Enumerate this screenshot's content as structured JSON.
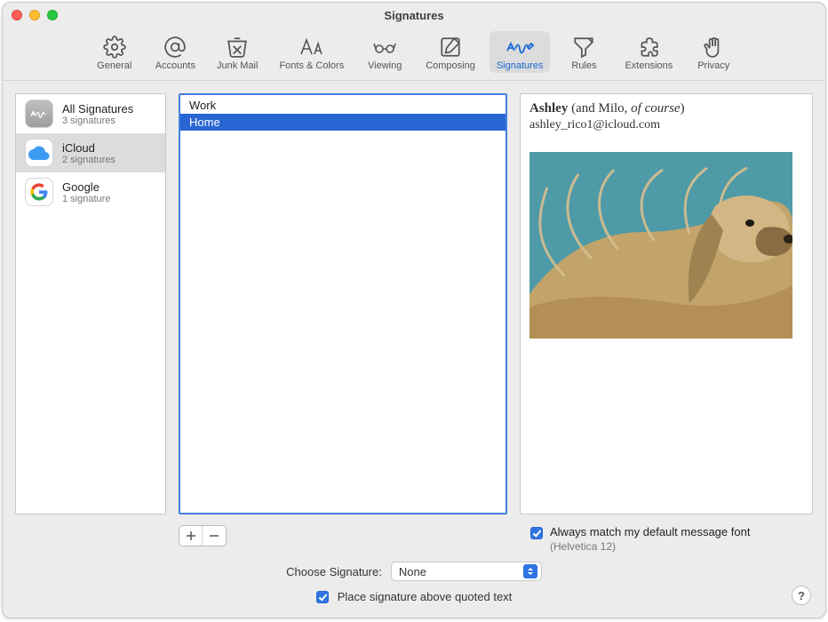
{
  "window": {
    "title": "Signatures"
  },
  "toolbar": [
    {
      "id": "general",
      "label": "General"
    },
    {
      "id": "accounts",
      "label": "Accounts"
    },
    {
      "id": "junk",
      "label": "Junk Mail"
    },
    {
      "id": "fonts",
      "label": "Fonts & Colors"
    },
    {
      "id": "viewing",
      "label": "Viewing"
    },
    {
      "id": "composing",
      "label": "Composing"
    },
    {
      "id": "signatures",
      "label": "Signatures",
      "active": true
    },
    {
      "id": "rules",
      "label": "Rules"
    },
    {
      "id": "extensions",
      "label": "Extensions"
    },
    {
      "id": "privacy",
      "label": "Privacy"
    }
  ],
  "accounts": [
    {
      "id": "all",
      "name": "All Signatures",
      "sub": "3 signatures",
      "icon": "all"
    },
    {
      "id": "icloud",
      "name": "iCloud",
      "sub": "2 signatures",
      "icon": "icloud",
      "selected": true
    },
    {
      "id": "google",
      "name": "Google",
      "sub": "1 signature",
      "icon": "google"
    }
  ],
  "signatures": [
    {
      "name": "Work"
    },
    {
      "name": "Home",
      "selected": true
    }
  ],
  "preview": {
    "name_bold": "Ashley",
    "name_plain": " (and Milo, ",
    "name_italic": "of  course",
    "name_close": ")",
    "email": "ashley_rico1@icloud.com"
  },
  "options": {
    "match_font_label": "Always match my default message font",
    "match_font_sub": "(Helvetica 12)",
    "match_font_checked": true,
    "choose_label": "Choose Signature:",
    "choose_value": "None",
    "place_above_label": "Place signature above quoted text",
    "place_above_checked": true
  },
  "help_label": "?"
}
